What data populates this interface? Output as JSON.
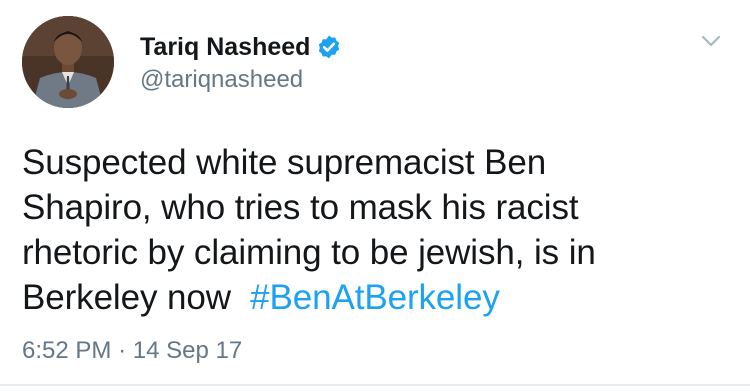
{
  "author": {
    "display_name": "Tariq Nasheed",
    "handle": "@tariqnasheed",
    "verified": true
  },
  "tweet": {
    "lines": [
      "Suspected white supremacist Ben",
      "Shapiro, who tries to mask his racist",
      "rhetoric by claiming to be jewish, is in",
      "Berkeley now"
    ],
    "hashtag": "#BenAtBerkeley",
    "time": "6:52 PM",
    "separator": "·",
    "date": "14 Sep 17"
  },
  "colors": {
    "text": "#14171a",
    "secondary": "#657786",
    "link": "#1da1f2",
    "verified": "#1da1f2"
  },
  "icons": {
    "verified": "verified-badge-icon",
    "menu": "chevron-down-icon"
  }
}
